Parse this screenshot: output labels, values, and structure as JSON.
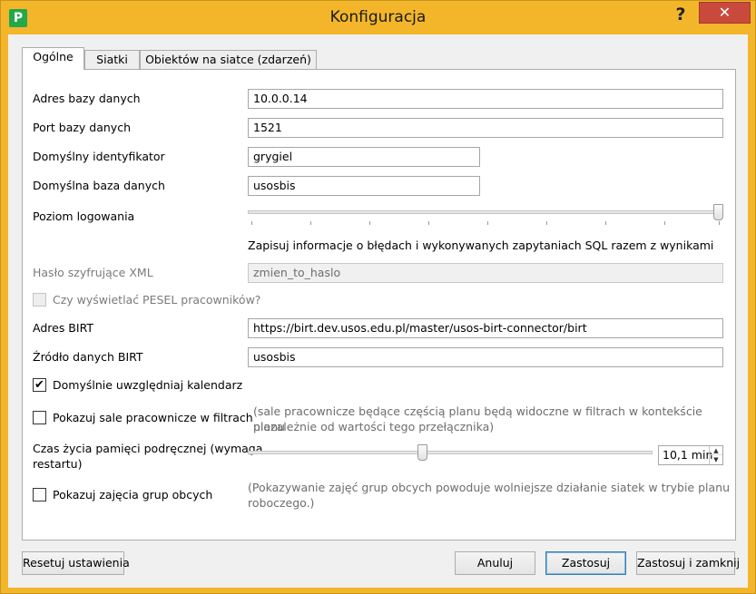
{
  "window": {
    "title": "Konfiguracja",
    "app_icon_letter": "P",
    "help_symbol": "?",
    "close_symbol": "✕"
  },
  "tabs": [
    {
      "label": "Ogólne",
      "active": true
    },
    {
      "label": "Siatki",
      "active": false
    },
    {
      "label": "Obiektów na siatce (zdarzeń)",
      "active": false
    }
  ],
  "form": {
    "db_address": {
      "label": "Adres bazy danych",
      "value": "10.0.0.14"
    },
    "db_port": {
      "label": "Port bazy danych",
      "value": "1521"
    },
    "default_id": {
      "label": "Domyślny identyfikator",
      "value": "grygiel"
    },
    "default_db": {
      "label": "Domyślna baza danych",
      "value": "usosbis"
    },
    "log_level": {
      "label": "Poziom logowania",
      "level_fraction": 1.0,
      "description": "Zapisuj informacje o błędach i wykonywanych zapytaniach SQL razem z wynikami"
    },
    "xml_password": {
      "label": "Hasło szyfrujące XML",
      "value": "zmien_to_haslo"
    },
    "show_pesel": {
      "label": "Czy wyświetlać PESEL pracowników?",
      "checked": false
    },
    "birt_address": {
      "label": "Adres BIRT",
      "value": "https://birt.dev.usos.edu.pl/master/usos-birt-connector/birt"
    },
    "birt_source": {
      "label": "Źródło danych BIRT",
      "value": "usosbis"
    },
    "include_calendar": {
      "label": "Domyślnie uwzględniaj kalendarz",
      "checked": true
    },
    "show_staff_rooms": {
      "label": "Pokazuj sale pracownicze w filtrach",
      "checked": false,
      "note_line1": "(sale pracownicze będące częścią planu będą widoczne w filtrach w kontekście planu",
      "note_line2": "niezależnie od wartości tego przełącznika)"
    },
    "cache_lifetime": {
      "label_line1": "Czas życia pamięci podręcznej (wymaga",
      "label_line2": "restartu)",
      "value": "10,1 min",
      "level_fraction": 0.43
    },
    "show_foreign_groups": {
      "label": "Pokazuj zajęcia grup obcych",
      "checked": false,
      "note_line1": "(Pokazywanie zajęć grup obcych powoduje wolniejsze działanie siatek w trybie planu",
      "note_line2": "roboczego.)"
    }
  },
  "buttons": {
    "reset": "Resetuj ustawienia",
    "cancel": "Anuluj",
    "apply": "Zastosuj",
    "apply_close": "Zastosuj i zamknij"
  }
}
